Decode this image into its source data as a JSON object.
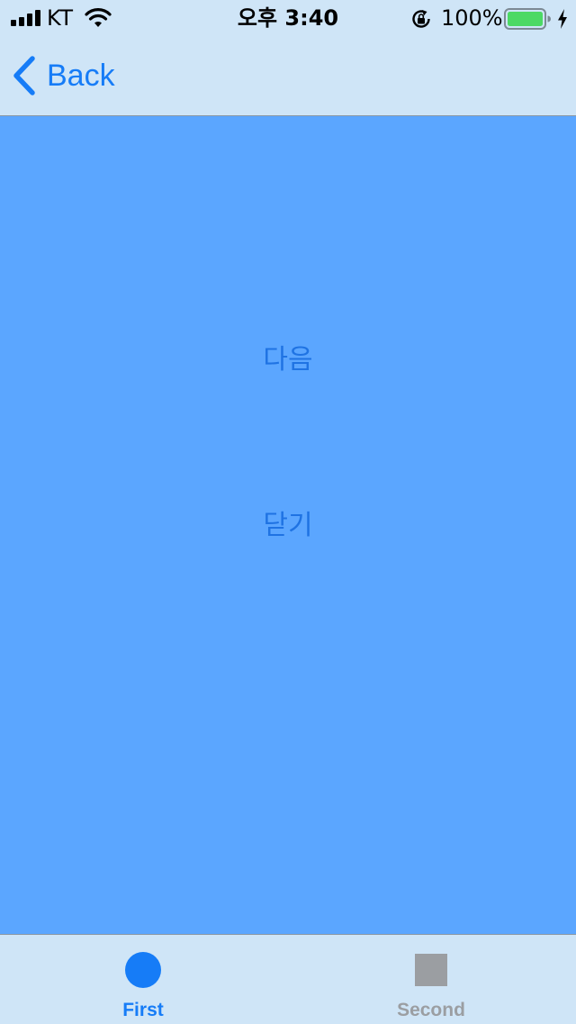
{
  "colors": {
    "bars_background": "#CFE5F7",
    "content_background": "#5BA6FF",
    "accent": "#167CF7",
    "content_button_text": "#1F73E3",
    "tab_selected": "#167CF7",
    "tab_unselected": "#9B9EA2",
    "battery_fill": "#4CD964"
  },
  "status_bar": {
    "carrier": "KT",
    "time": "오후 3:40",
    "battery_percent": "100%",
    "battery_level": 1.0,
    "icons": [
      "signal-bars-icon",
      "wifi-icon",
      "rotation-lock-icon",
      "battery-icon",
      "charging-bolt-icon"
    ]
  },
  "nav_bar": {
    "back_label": "Back",
    "back_icon": "chevron-left-icon"
  },
  "content": {
    "next_label": "다음",
    "close_label": "닫기"
  },
  "tab_bar": {
    "tabs": [
      {
        "label": "First",
        "icon": "circle-icon",
        "selected": true
      },
      {
        "label": "Second",
        "icon": "square-icon",
        "selected": false
      }
    ]
  }
}
